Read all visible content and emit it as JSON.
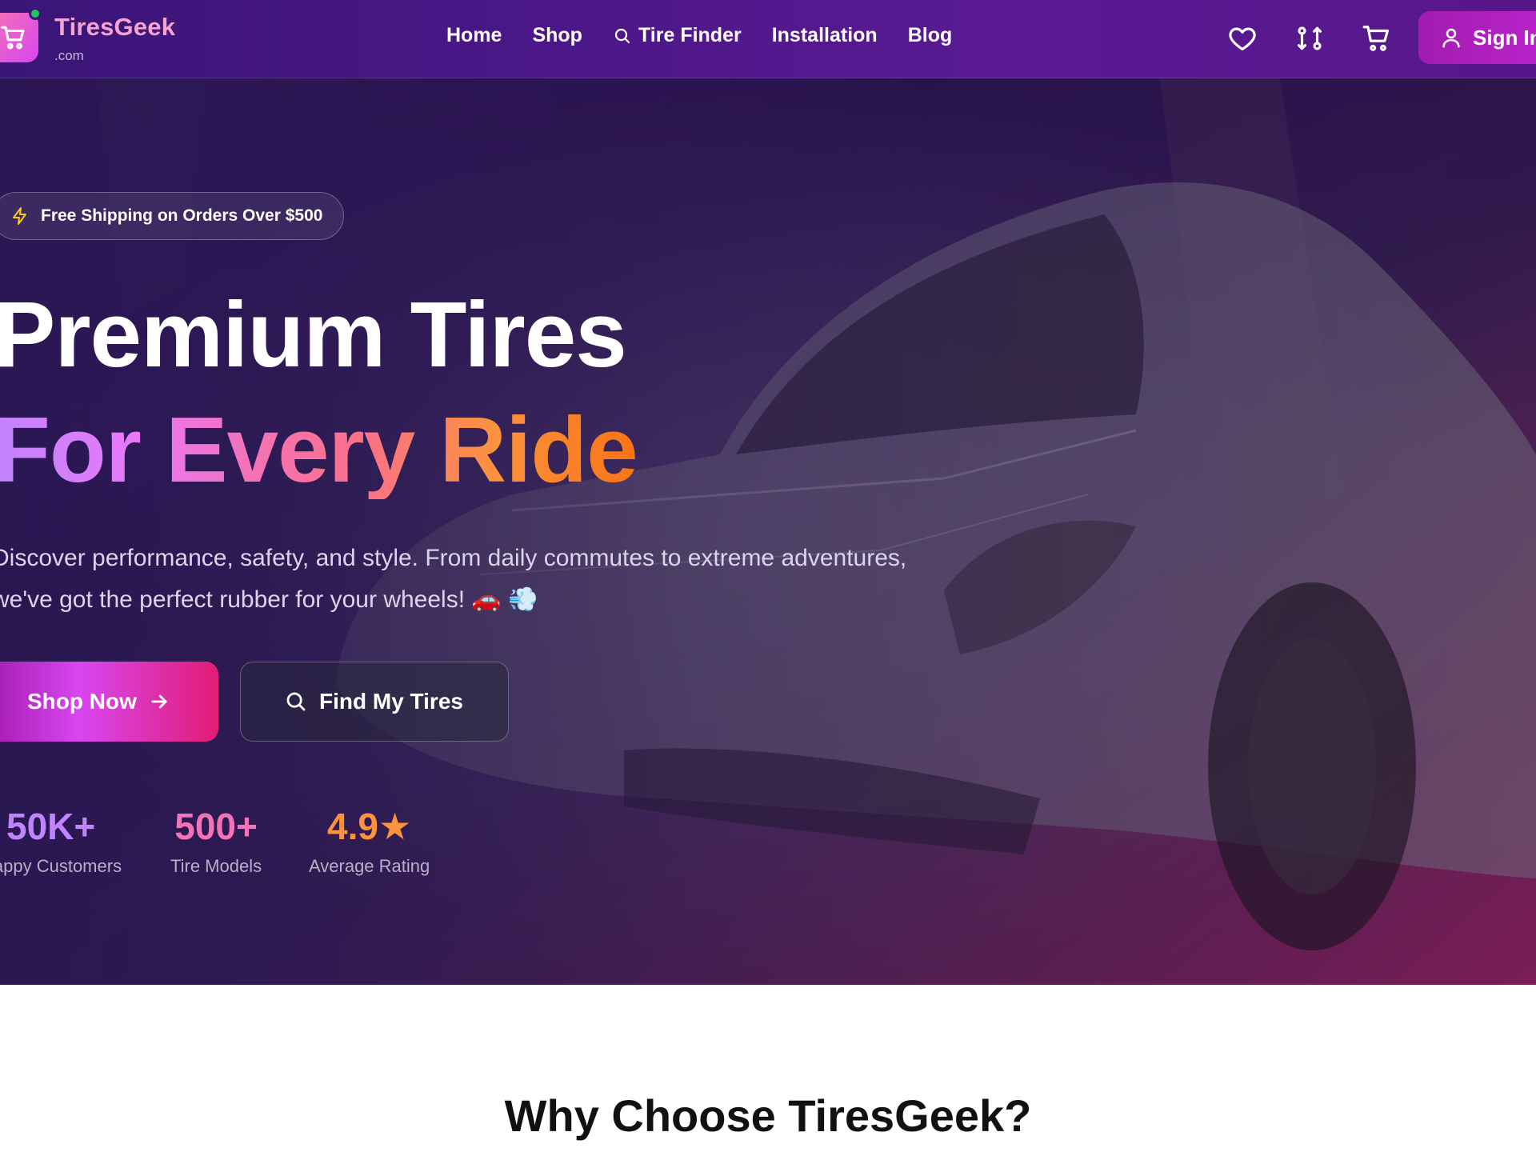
{
  "brand": {
    "name": "TiresGeek",
    "suffix": ".com"
  },
  "nav": {
    "items": [
      {
        "label": "Home"
      },
      {
        "label": "Shop"
      },
      {
        "label": "Tire Finder",
        "icon": "search-icon"
      },
      {
        "label": "Installation"
      },
      {
        "label": "Blog"
      }
    ]
  },
  "header_actions": {
    "icons": [
      "heart-icon",
      "compare-icon",
      "cart-icon"
    ],
    "signin_label": "Sign In"
  },
  "hero": {
    "promo_text": "Free Shipping on Orders Over $500",
    "title_line1": "Premium Tires",
    "title_line2": "For Every Ride",
    "subtitle_line1": "Discover performance, safety, and style. From daily commutes to extreme adventures,",
    "subtitle_line2": "we've got the perfect rubber for your wheels! 🚗 💨",
    "primary_button": "Shop Now",
    "secondary_button": "Find My Tires",
    "stats": [
      {
        "value": "50K+",
        "label": "Happy Customers",
        "color": "#c084fc"
      },
      {
        "value": "500+",
        "label": "Tire Models",
        "color": "#f472b6"
      },
      {
        "value": "4.9★",
        "label": "Average Rating",
        "color": "#fb923c"
      }
    ]
  },
  "why_section": {
    "title": "Why Choose TiresGeek?"
  },
  "colors": {
    "header_bg": "#4b1787",
    "accent_pink": "#d946ef",
    "accent_orange": "#fb923c",
    "hero_bg": "#2a1752"
  }
}
